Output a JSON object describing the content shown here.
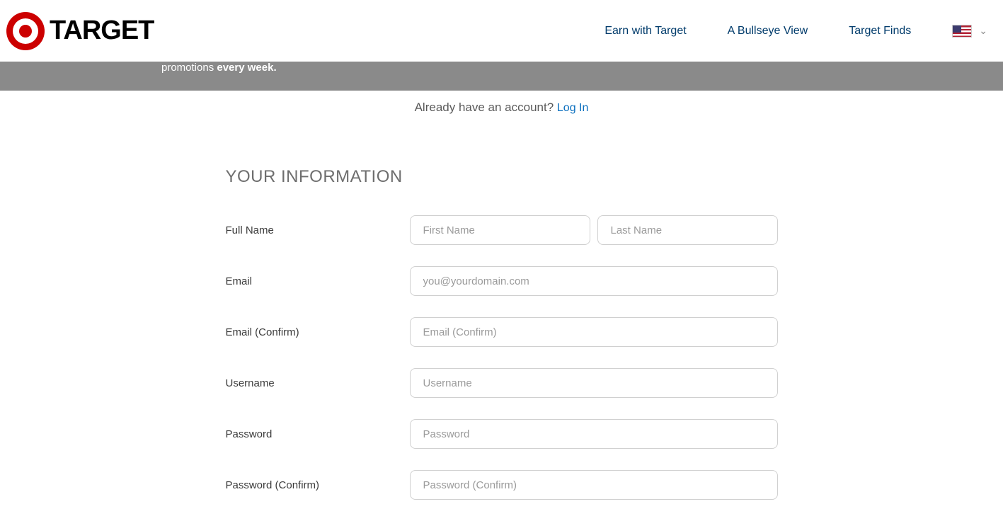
{
  "header": {
    "brand": "TARGET",
    "nav": [
      {
        "label": "Earn with Target"
      },
      {
        "label": "A Bullseye View"
      },
      {
        "label": "Target Finds"
      }
    ]
  },
  "banner": {
    "text_thin": "promotions ",
    "text_bold": "every week."
  },
  "login_prompt": {
    "text": "Already have an account? ",
    "link": "Log In"
  },
  "form": {
    "section_title": "YOUR INFORMATION",
    "fields": {
      "full_name": {
        "label": "Full Name",
        "first_placeholder": "First Name",
        "last_placeholder": "Last Name"
      },
      "email": {
        "label": "Email",
        "placeholder": "you@yourdomain.com"
      },
      "email_confirm": {
        "label": "Email (Confirm)",
        "placeholder": "Email (Confirm)"
      },
      "username": {
        "label": "Username",
        "placeholder": "Username"
      },
      "password": {
        "label": "Password",
        "placeholder": "Password"
      },
      "password_confirm": {
        "label": "Password (Confirm)",
        "placeholder": "Password (Confirm)"
      }
    }
  }
}
